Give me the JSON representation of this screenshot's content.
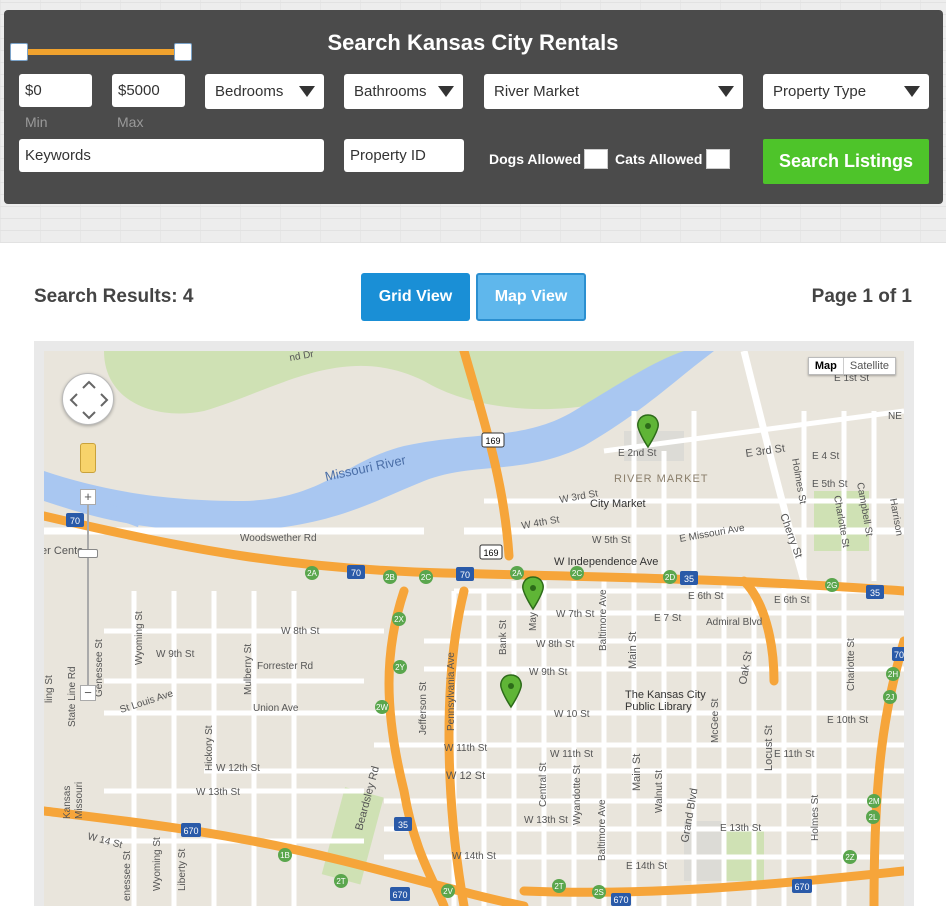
{
  "search_panel": {
    "title": "Search Kansas City Rentals",
    "price_min": {
      "value": "$0",
      "label": "Min"
    },
    "price_max": {
      "value": "$5000",
      "label": "Max"
    },
    "bedrooms": "Bedrooms",
    "bathrooms": "Bathrooms",
    "neighborhood": "River Market",
    "property_type": "Property Type",
    "keywords": "Keywords",
    "property_id": "Property ID",
    "dogs_allowed": "Dogs Allowed",
    "cats_allowed": "Cats Allowed",
    "search_button": "Search Listings",
    "price_slider": {
      "min_fraction": 0.0,
      "max_fraction": 1.0
    }
  },
  "results_bar": {
    "count_text": "Search Results: 4",
    "grid_view": "Grid View",
    "map_view": "Map View",
    "page_text": "Page 1 of 1"
  },
  "map": {
    "map_type": {
      "map": "Map",
      "satellite": "Satellite"
    },
    "zoom_in": "+",
    "zoom_out": "−",
    "labels": {
      "river": "Missouri River",
      "river_market": "RIVER MARKET",
      "city_market": "City Market",
      "library_1": "The Kansas City",
      "library_2": "Public Library",
      "w_independence": "W Independence Ave",
      "e_missouri": "E Missouri Ave",
      "e_6th": "E 6th St",
      "e_6th_b": "E 6th St",
      "w_7th": "W 7th St",
      "e_7": "E 7 St",
      "admiral": "Admiral Blvd",
      "w_8th": "W 8th St",
      "w_8th_b": "W 8th St",
      "w_9th": "W 9th St",
      "w_9th_b": "W 9th St",
      "w_10th": "W 10 St",
      "e_10th": "E 10th St",
      "w_11th": "W 11th St",
      "w_11th_b": "W 11th St",
      "e_11th": "E 11th St",
      "w_12th": "W 12 St",
      "w_12th_b": "W 12th St",
      "w_13th": "W 13th St",
      "w_13th_b": "W 13th St",
      "e_13th": "E 13th St",
      "w_14th": "W 14th St",
      "e_14th": "E 14th St",
      "w_14": "W 14 St",
      "e_2nd": "E 2nd St",
      "e_3rd": "E 3rd St",
      "w_3rd": "W 3rd St",
      "w_4th": "W 4th St",
      "e_4": "E 4 St",
      "e_5th": "E 5th St",
      "w_5th": "W 5th St",
      "e_1st": "E 1st St",
      "woodsweather": "Woodswether Rd",
      "forrester": "Forrester Rd",
      "st_louis": "St Louis Ave",
      "union": "Union Ave",
      "beardsley": "Beardsley Rd",
      "main": "Main St",
      "main_b": "Main St",
      "grand": "Grand Blvd",
      "oak": "Oak St",
      "locust": "Locust St",
      "cherry": "Cherry St",
      "holmes": "Holmes St",
      "holmes_b": "Holmes St",
      "charlotte": "Charlotte St",
      "charlotte_b": "Charlotte St",
      "campbell": "Campbell St",
      "harrison": "Harrison",
      "baltimore": "Baltimore Ave",
      "baltimore_b": "Baltimore Ave",
      "wyandotte": "Wyandotte St",
      "central": "Central St",
      "broadway": "Broadway",
      "jefferson": "Jefferson St",
      "pennsylvania": "Pennsylvania Ave",
      "bank": "Bank St",
      "may": "May",
      "walnut": "Walnut St",
      "mcgee": "McGee St",
      "wyoming": "Wyoming St",
      "wyoming_b": "Wyoming St",
      "genessee": "Genessee St",
      "genessee_b": "enessee St",
      "mulberry": "Mulberry St",
      "hickory": "Hickory St",
      "liberty": "Liberty St",
      "state_line": "State Line Rd",
      "missouri_kansas": "Missouri",
      "kansas": "Kansas",
      "center": "ter Cente",
      "nd_dr": "nd Dr",
      "ne": "NE",
      "ling": "ling St",
      "hwy_70": "70",
      "hwy_70b": "70",
      "hwy_70c": "70",
      "hwy_70d": "70",
      "hwy_169": "169",
      "hwy_169b": "169",
      "hwy_35": "35",
      "hwy_35b": "35",
      "hwy_35c": "35",
      "hwy_670": "670",
      "hwy_670b": "670",
      "hwy_670c": "670",
      "hwy_670d": "670"
    },
    "exits": [
      "2A",
      "2B",
      "2C",
      "2A",
      "2C",
      "2D",
      "2E",
      "2G",
      "2Y",
      "2X",
      "2W",
      "2V",
      "2T",
      "2S",
      "2Y",
      "2J",
      "2H",
      "2M",
      "2L",
      "1B",
      "2T",
      "2U",
      "2Z",
      "2X",
      "2E"
    ]
  }
}
